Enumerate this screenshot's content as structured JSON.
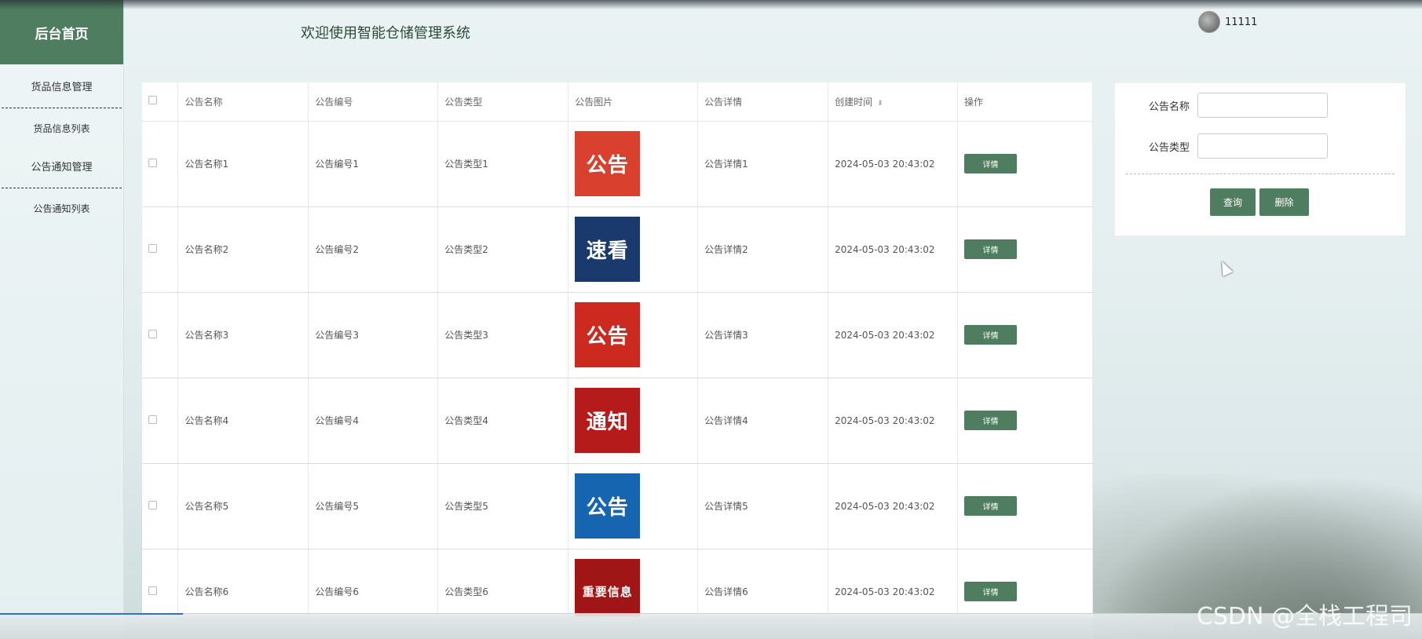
{
  "sidebar": {
    "brand": "后台首页",
    "items": [
      {
        "label": "货品信息管理"
      },
      {
        "label": "货品信息列表"
      },
      {
        "label": "公告通知管理"
      },
      {
        "label": "公告通知列表"
      }
    ]
  },
  "header": {
    "welcome": "欢迎使用智能仓储管理系统",
    "username": "11111"
  },
  "table": {
    "columns": [
      "公告名称",
      "公告编号",
      "公告类型",
      "公告图片",
      "公告详情",
      "创建时间",
      "操作"
    ],
    "rows": [
      {
        "name": "公告名称1",
        "code": "公告编号1",
        "type": "公告类型1",
        "image_text": "公告",
        "detail": "公告详情1",
        "time": "2024-05-03 20:43:02",
        "action": "详情"
      },
      {
        "name": "公告名称2",
        "code": "公告编号2",
        "type": "公告类型2",
        "image_text": "速看",
        "detail": "公告详情2",
        "time": "2024-05-03 20:43:02",
        "action": "详情"
      },
      {
        "name": "公告名称3",
        "code": "公告编号3",
        "type": "公告类型3",
        "image_text": "公告",
        "detail": "公告详情3",
        "time": "2024-05-03 20:43:02",
        "action": "详情"
      },
      {
        "name": "公告名称4",
        "code": "公告编号4",
        "type": "公告类型4",
        "image_text": "通知",
        "detail": "公告详情4",
        "time": "2024-05-03 20:43:02",
        "action": "详情"
      },
      {
        "name": "公告名称5",
        "code": "公告编号5",
        "type": "公告类型5",
        "image_text": "公告",
        "detail": "公告详情5",
        "time": "2024-05-03 20:43:02",
        "action": "详情"
      },
      {
        "name": "公告名称6",
        "code": "公告编号6",
        "type": "公告类型6",
        "image_text": "重要信息",
        "detail": "公告详情6",
        "time": "2024-05-03 20:43:02",
        "action": "详情"
      }
    ]
  },
  "search": {
    "name_label": "公告名称",
    "name_value": "",
    "type_label": "公告类型",
    "type_value": "",
    "query_label": "查询",
    "delete_label": "删除"
  },
  "watermark": "CSDN @全栈工程司",
  "colors": {
    "accent": "#4f7d5f",
    "thumb_bg": [
      "#d9412e",
      "#1a3a6e",
      "#cc2a1e",
      "#b51b1b",
      "#1565b0",
      "#a01616"
    ]
  }
}
